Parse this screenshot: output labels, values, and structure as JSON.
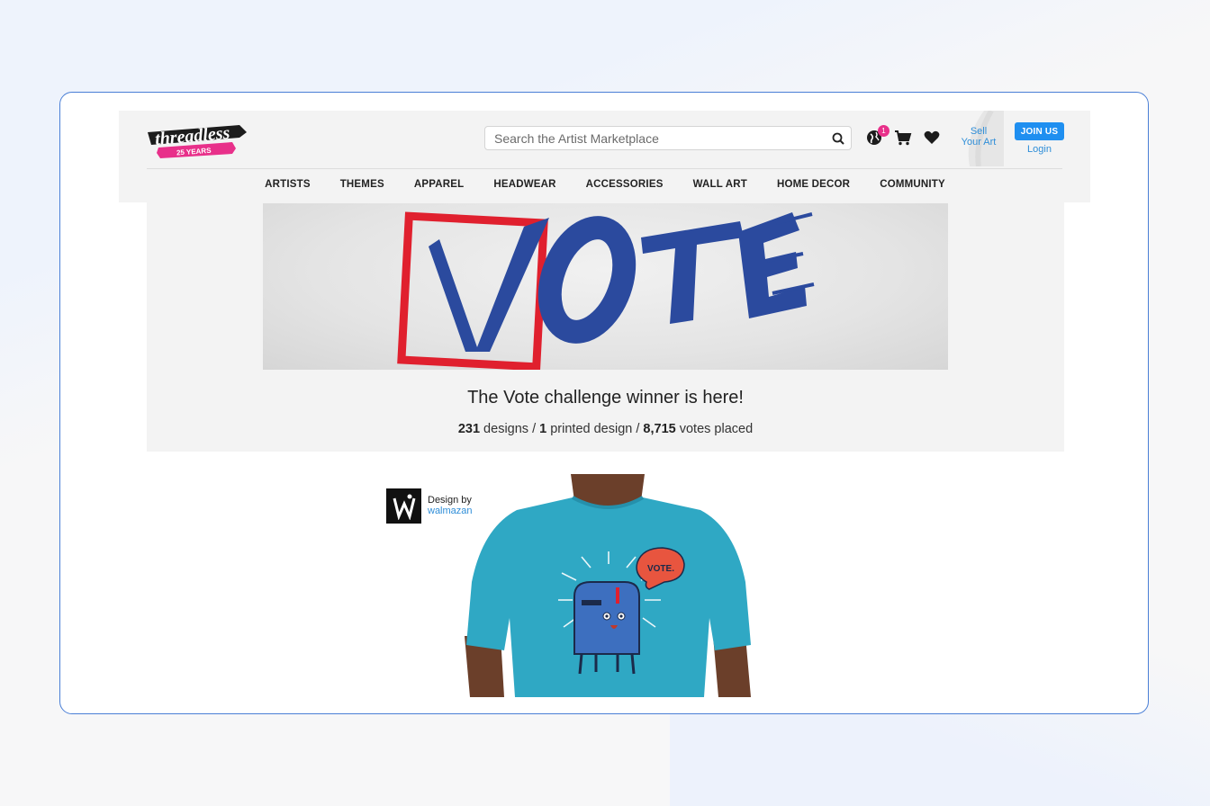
{
  "header": {
    "logo_text": "threadless",
    "logo_ribbon": "25 YEARS",
    "search_placeholder": "Search the Artist Marketplace",
    "notification_count": "1",
    "sell_line1": "Sell",
    "sell_line2": "Your Art",
    "join_label": "JOIN US",
    "login_label": "Login"
  },
  "nav": {
    "items": [
      "ARTISTS",
      "THEMES",
      "APPAREL",
      "HEADWEAR",
      "ACCESSORIES",
      "WALL ART",
      "HOME DECOR",
      "COMMUNITY"
    ]
  },
  "hero": {
    "banner_text": "VOTE",
    "title": "The Vote challenge winner is here!",
    "designs_count": "231",
    "designs_label": " designs / ",
    "printed_count": "1",
    "printed_label": " printed design / ",
    "votes_count": "8,715",
    "votes_label": " votes placed"
  },
  "product": {
    "design_by": "Design by",
    "designer": "walmazan",
    "speech_bubble": "VOTE.",
    "shirt_color": "#2fa8c4"
  },
  "colors": {
    "accent": "#1f8ff0",
    "badge": "#e8308a",
    "vote_blue": "#2b4a9e",
    "vote_red": "#e0202e"
  }
}
